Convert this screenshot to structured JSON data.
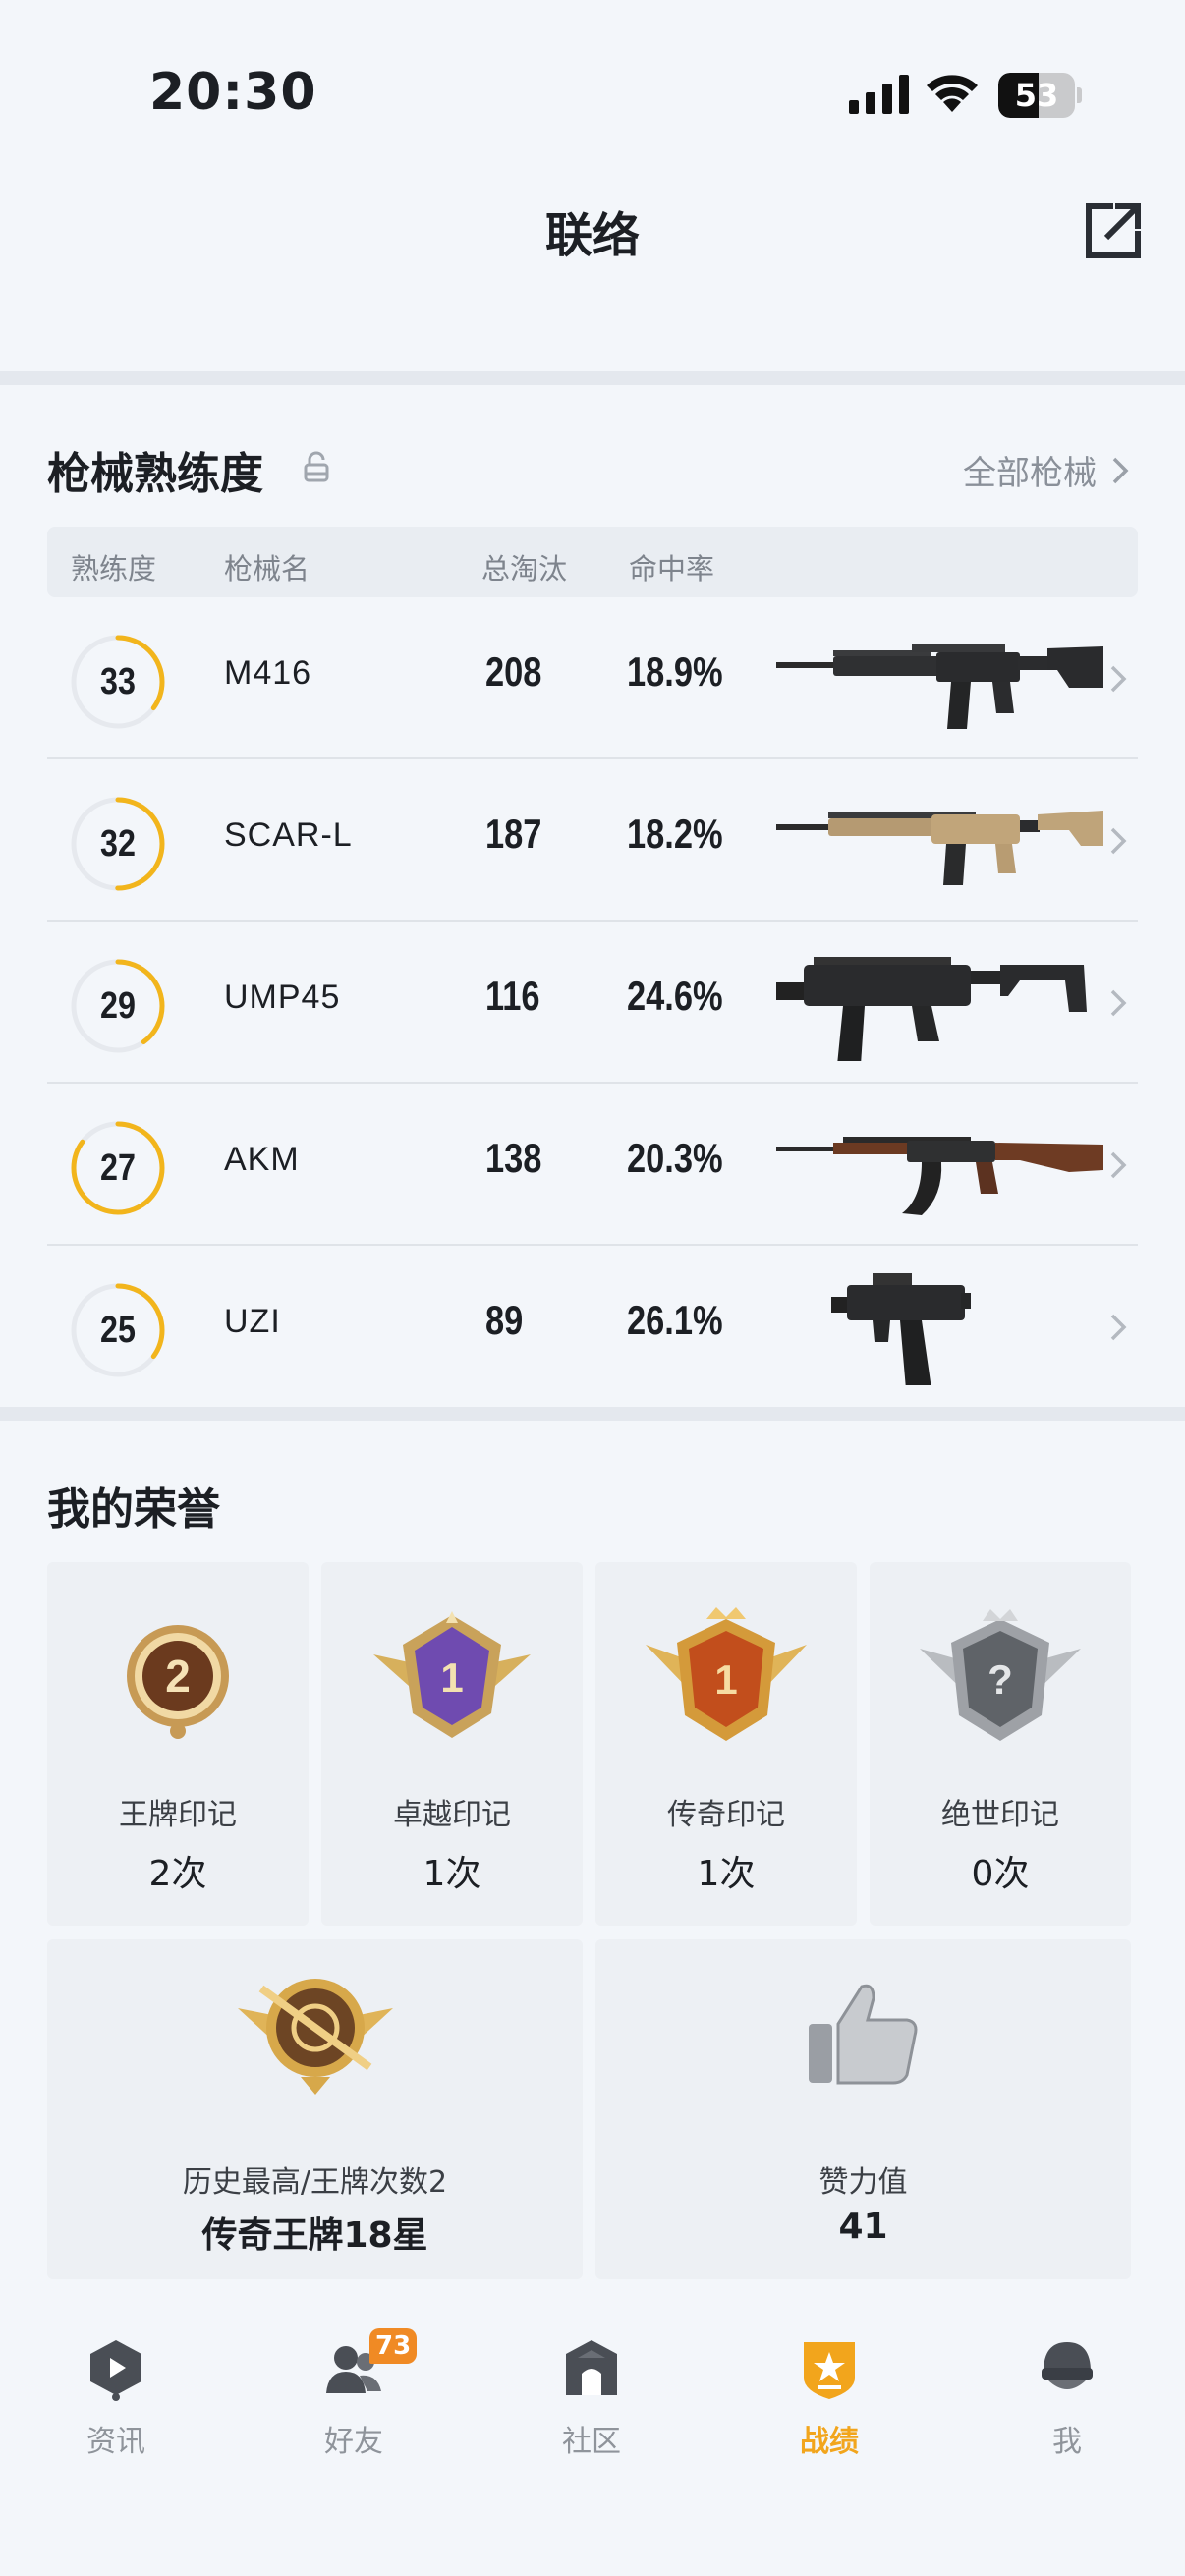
{
  "status_bar": {
    "time": "20:30",
    "battery": "53",
    "battery_level": 0.53
  },
  "header": {
    "title": "联络"
  },
  "weapons": {
    "section_title": "枪械熟练度",
    "all_link": "全部枪械",
    "columns": [
      "熟练度",
      "枪械名",
      "总淘汰",
      "命中率"
    ],
    "rows": [
      {
        "level": "33",
        "progress": 0.35,
        "name": "M416",
        "kills": "208",
        "accuracy": "18.9%",
        "icon": "m416-rifle-image"
      },
      {
        "level": "32",
        "progress": 0.5,
        "name": "SCAR-L",
        "kills": "187",
        "accuracy": "18.2%",
        "icon": "scar-l-rifle-image"
      },
      {
        "level": "29",
        "progress": 0.4,
        "name": "UMP45",
        "kills": "116",
        "accuracy": "24.6%",
        "icon": "ump45-smg-image"
      },
      {
        "level": "27",
        "progress": 0.85,
        "name": "AKM",
        "kills": "138",
        "accuracy": "20.3%",
        "icon": "akm-rifle-image"
      },
      {
        "level": "25",
        "progress": 0.35,
        "name": "UZI",
        "kills": "89",
        "accuracy": "26.1%",
        "icon": "uzi-smg-image"
      }
    ]
  },
  "honors": {
    "section_title": "我的荣誉",
    "marks": [
      {
        "label": "王牌印记",
        "count": "2次",
        "badge_number": "2",
        "icon": "ace-mark-badge"
      },
      {
        "label": "卓越印记",
        "count": "1次",
        "badge_number": "1",
        "icon": "excellence-mark-badge"
      },
      {
        "label": "传奇印记",
        "count": "1次",
        "badge_number": "1",
        "icon": "legend-mark-badge"
      },
      {
        "label": "绝世印记",
        "count": "0次",
        "badge_number": "?",
        "icon": "peerless-mark-badge"
      }
    ],
    "highest": {
      "label": "历史最高/王牌次数2",
      "value": "传奇王牌18星",
      "icon": "legend-ace-badge"
    },
    "likes": {
      "label": "赞力值",
      "value": "41",
      "icon": "thumbs-up-icon"
    }
  },
  "tab_bar": {
    "tabs": [
      {
        "label": "资讯",
        "icon": "news-icon",
        "active": false
      },
      {
        "label": "好友",
        "icon": "friends-icon",
        "active": false,
        "badge": "73"
      },
      {
        "label": "社区",
        "icon": "community-icon",
        "active": false
      },
      {
        "label": "战绩",
        "icon": "stats-icon",
        "active": true
      },
      {
        "label": "我",
        "icon": "profile-icon",
        "active": false
      }
    ]
  },
  "colors": {
    "accent": "#f2a51c",
    "ring_track": "#e6e9ee",
    "background": "#f3f6fa"
  }
}
